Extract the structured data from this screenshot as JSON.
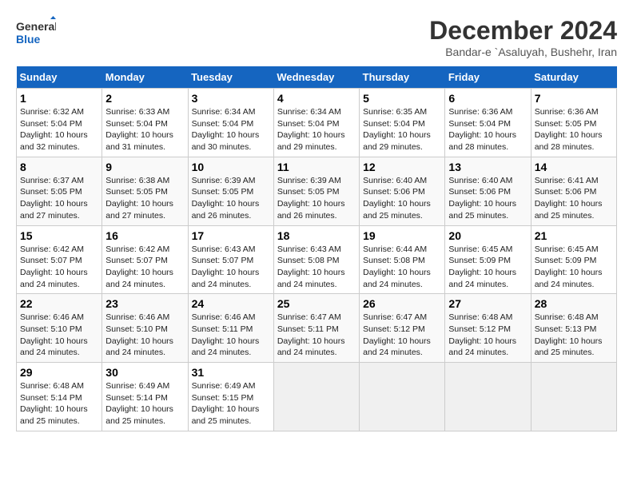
{
  "header": {
    "logo_general": "General",
    "logo_blue": "Blue",
    "title": "December 2024",
    "subtitle": "Bandar-e `Asaluyah, Bushehr, Iran"
  },
  "calendar": {
    "days_of_week": [
      "Sunday",
      "Monday",
      "Tuesday",
      "Wednesday",
      "Thursday",
      "Friday",
      "Saturday"
    ],
    "weeks": [
      [
        {
          "day": "1",
          "info": "Sunrise: 6:32 AM\nSunset: 5:04 PM\nDaylight: 10 hours\nand 32 minutes."
        },
        {
          "day": "2",
          "info": "Sunrise: 6:33 AM\nSunset: 5:04 PM\nDaylight: 10 hours\nand 31 minutes."
        },
        {
          "day": "3",
          "info": "Sunrise: 6:34 AM\nSunset: 5:04 PM\nDaylight: 10 hours\nand 30 minutes."
        },
        {
          "day": "4",
          "info": "Sunrise: 6:34 AM\nSunset: 5:04 PM\nDaylight: 10 hours\nand 29 minutes."
        },
        {
          "day": "5",
          "info": "Sunrise: 6:35 AM\nSunset: 5:04 PM\nDaylight: 10 hours\nand 29 minutes."
        },
        {
          "day": "6",
          "info": "Sunrise: 6:36 AM\nSunset: 5:04 PM\nDaylight: 10 hours\nand 28 minutes."
        },
        {
          "day": "7",
          "info": "Sunrise: 6:36 AM\nSunset: 5:05 PM\nDaylight: 10 hours\nand 28 minutes."
        }
      ],
      [
        {
          "day": "8",
          "info": "Sunrise: 6:37 AM\nSunset: 5:05 PM\nDaylight: 10 hours\nand 27 minutes."
        },
        {
          "day": "9",
          "info": "Sunrise: 6:38 AM\nSunset: 5:05 PM\nDaylight: 10 hours\nand 27 minutes."
        },
        {
          "day": "10",
          "info": "Sunrise: 6:39 AM\nSunset: 5:05 PM\nDaylight: 10 hours\nand 26 minutes."
        },
        {
          "day": "11",
          "info": "Sunrise: 6:39 AM\nSunset: 5:05 PM\nDaylight: 10 hours\nand 26 minutes."
        },
        {
          "day": "12",
          "info": "Sunrise: 6:40 AM\nSunset: 5:06 PM\nDaylight: 10 hours\nand 25 minutes."
        },
        {
          "day": "13",
          "info": "Sunrise: 6:40 AM\nSunset: 5:06 PM\nDaylight: 10 hours\nand 25 minutes."
        },
        {
          "day": "14",
          "info": "Sunrise: 6:41 AM\nSunset: 5:06 PM\nDaylight: 10 hours\nand 25 minutes."
        }
      ],
      [
        {
          "day": "15",
          "info": "Sunrise: 6:42 AM\nSunset: 5:07 PM\nDaylight: 10 hours\nand 24 minutes."
        },
        {
          "day": "16",
          "info": "Sunrise: 6:42 AM\nSunset: 5:07 PM\nDaylight: 10 hours\nand 24 minutes."
        },
        {
          "day": "17",
          "info": "Sunrise: 6:43 AM\nSunset: 5:07 PM\nDaylight: 10 hours\nand 24 minutes."
        },
        {
          "day": "18",
          "info": "Sunrise: 6:43 AM\nSunset: 5:08 PM\nDaylight: 10 hours\nand 24 minutes."
        },
        {
          "day": "19",
          "info": "Sunrise: 6:44 AM\nSunset: 5:08 PM\nDaylight: 10 hours\nand 24 minutes."
        },
        {
          "day": "20",
          "info": "Sunrise: 6:45 AM\nSunset: 5:09 PM\nDaylight: 10 hours\nand 24 minutes."
        },
        {
          "day": "21",
          "info": "Sunrise: 6:45 AM\nSunset: 5:09 PM\nDaylight: 10 hours\nand 24 minutes."
        }
      ],
      [
        {
          "day": "22",
          "info": "Sunrise: 6:46 AM\nSunset: 5:10 PM\nDaylight: 10 hours\nand 24 minutes."
        },
        {
          "day": "23",
          "info": "Sunrise: 6:46 AM\nSunset: 5:10 PM\nDaylight: 10 hours\nand 24 minutes."
        },
        {
          "day": "24",
          "info": "Sunrise: 6:46 AM\nSunset: 5:11 PM\nDaylight: 10 hours\nand 24 minutes."
        },
        {
          "day": "25",
          "info": "Sunrise: 6:47 AM\nSunset: 5:11 PM\nDaylight: 10 hours\nand 24 minutes."
        },
        {
          "day": "26",
          "info": "Sunrise: 6:47 AM\nSunset: 5:12 PM\nDaylight: 10 hours\nand 24 minutes."
        },
        {
          "day": "27",
          "info": "Sunrise: 6:48 AM\nSunset: 5:12 PM\nDaylight: 10 hours\nand 24 minutes."
        },
        {
          "day": "28",
          "info": "Sunrise: 6:48 AM\nSunset: 5:13 PM\nDaylight: 10 hours\nand 25 minutes."
        }
      ],
      [
        {
          "day": "29",
          "info": "Sunrise: 6:48 AM\nSunset: 5:14 PM\nDaylight: 10 hours\nand 25 minutes."
        },
        {
          "day": "30",
          "info": "Sunrise: 6:49 AM\nSunset: 5:14 PM\nDaylight: 10 hours\nand 25 minutes."
        },
        {
          "day": "31",
          "info": "Sunrise: 6:49 AM\nSunset: 5:15 PM\nDaylight: 10 hours\nand 25 minutes."
        },
        {
          "day": "",
          "info": ""
        },
        {
          "day": "",
          "info": ""
        },
        {
          "day": "",
          "info": ""
        },
        {
          "day": "",
          "info": ""
        }
      ]
    ]
  }
}
